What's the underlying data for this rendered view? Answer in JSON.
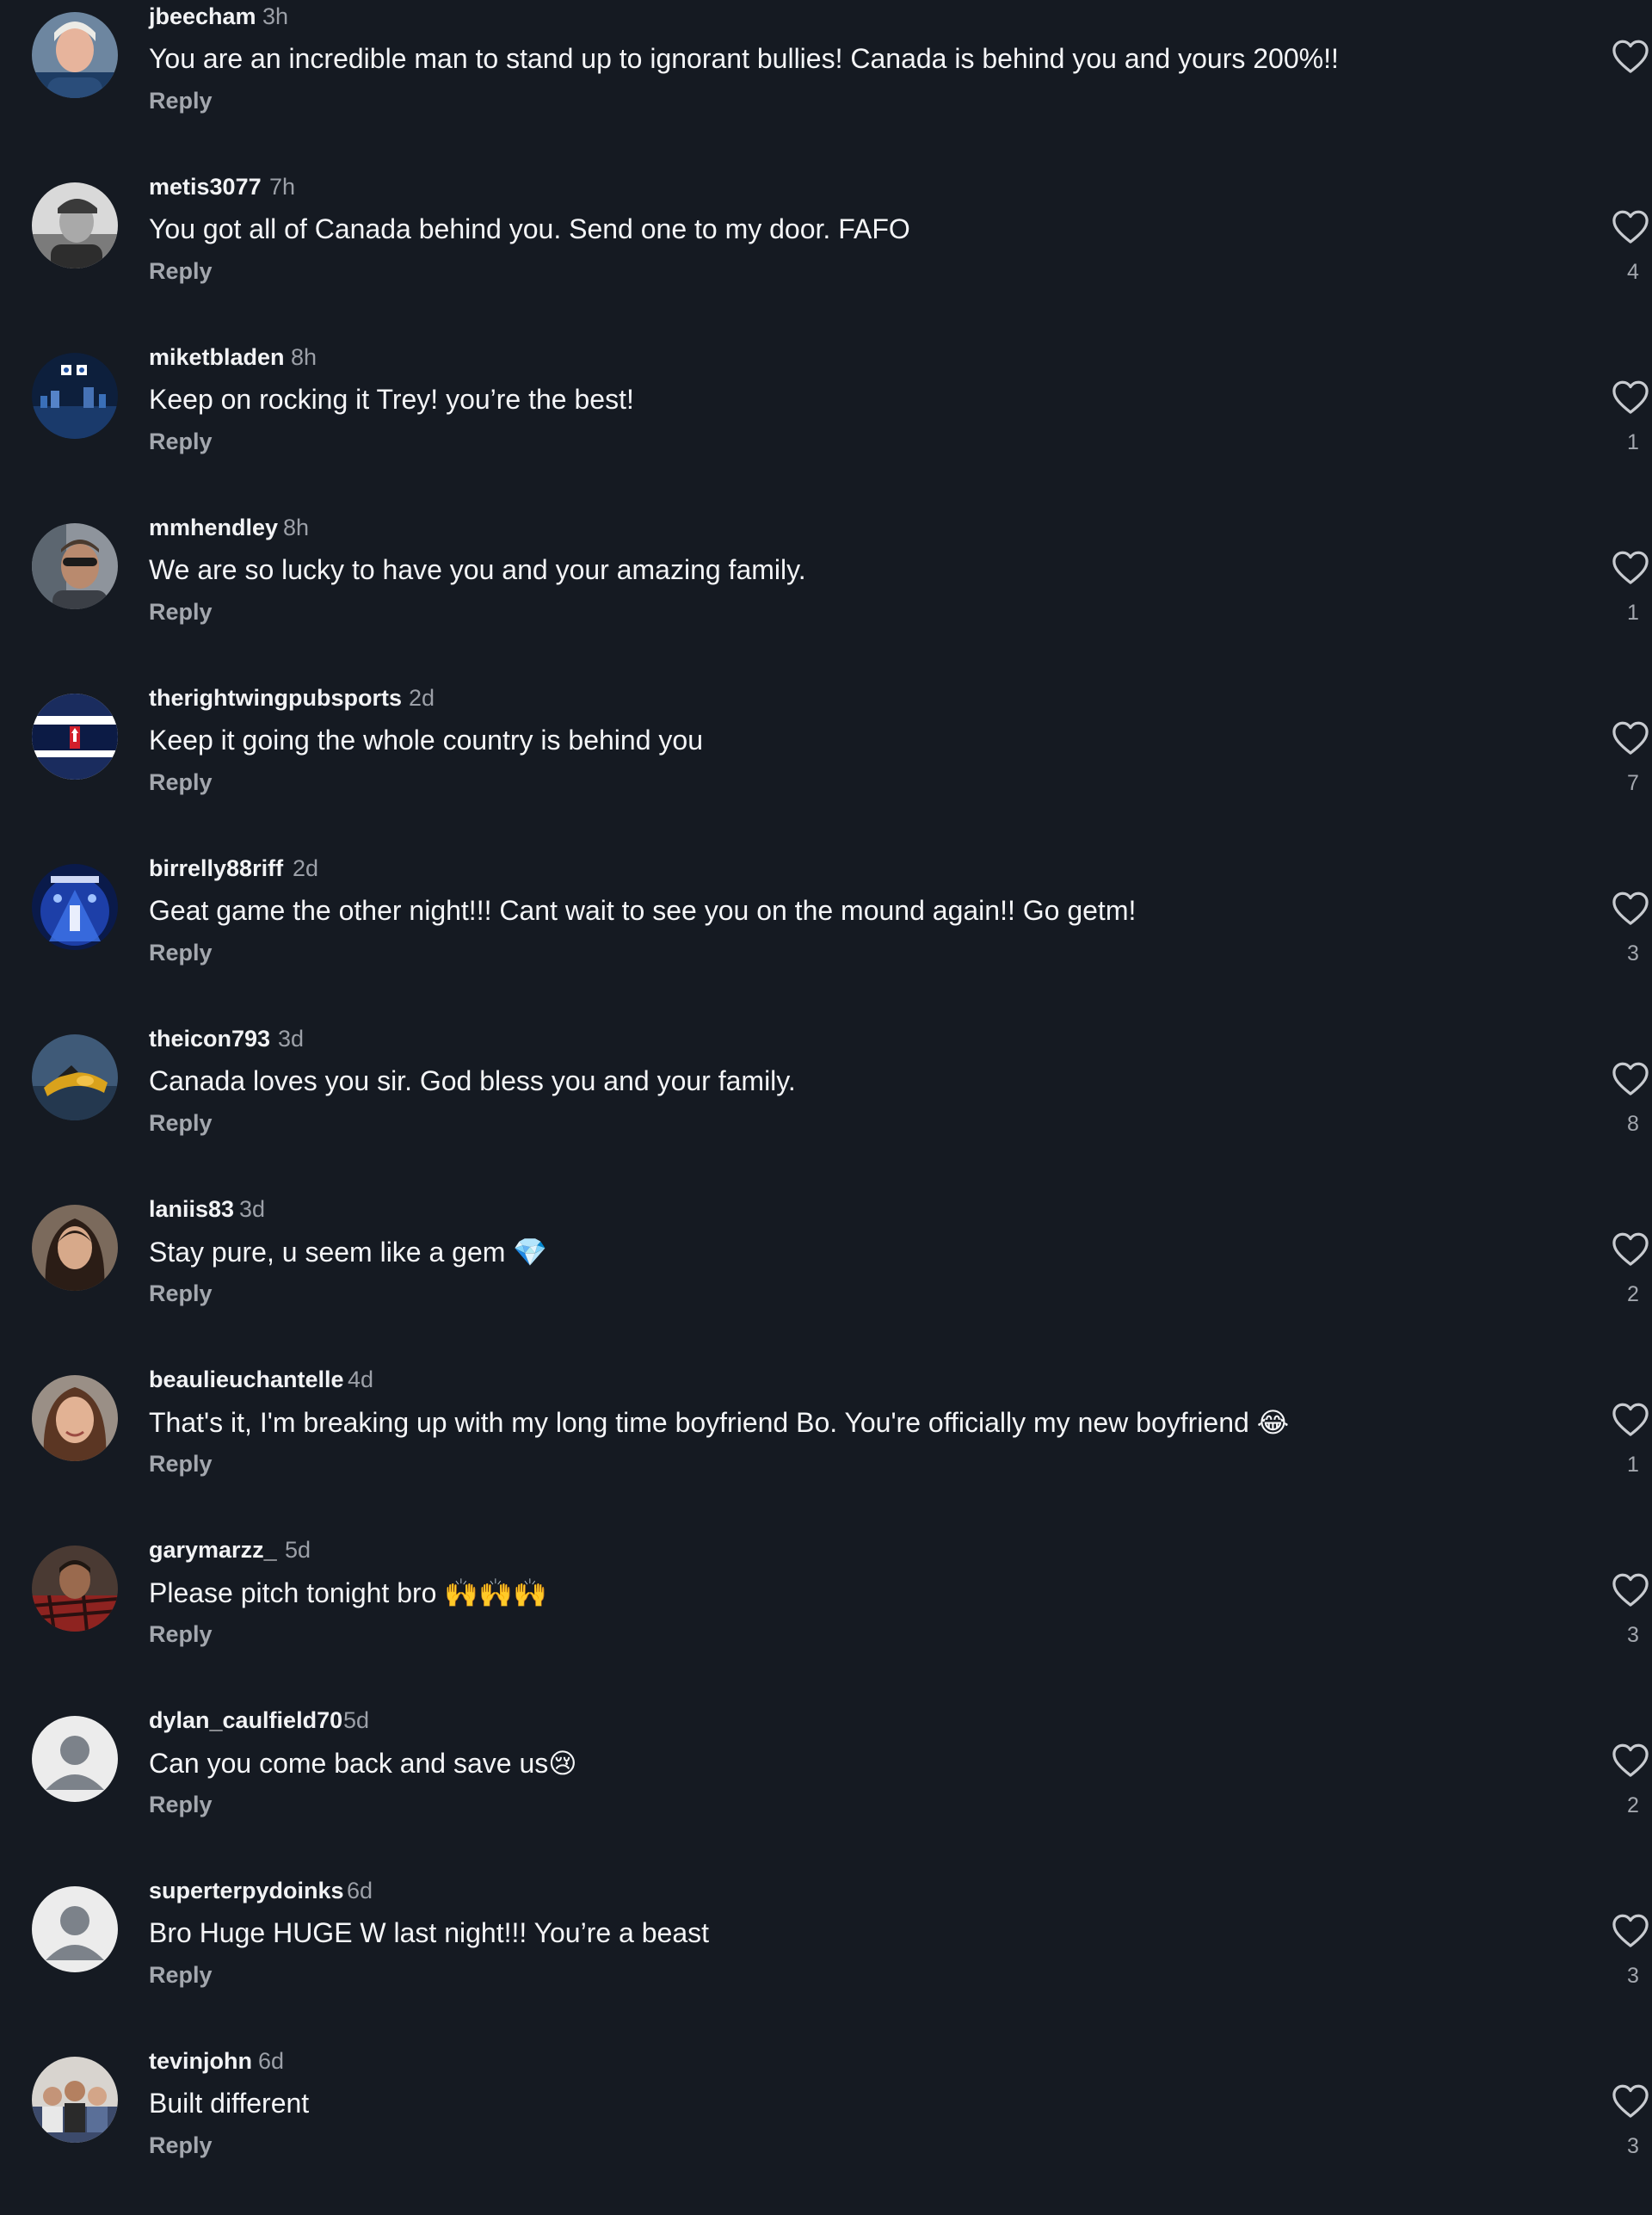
{
  "reply_label": "Reply",
  "colors": {
    "background": "#151a22",
    "text": "#f2f3f5",
    "muted": "#9ca0a8",
    "heart_outline": "#c8cbd0"
  },
  "comments": [
    {
      "username": "jbeecham",
      "time": "3h",
      "text": "You are an incredible man to stand up to ignorant bullies! Canada is behind you and yours 200%!!",
      "likes": "",
      "avatar": "photo-portrait"
    },
    {
      "username": "metis3077",
      "time": "7h",
      "text": "You got all of Canada behind you. Send one to my door. FAFO",
      "likes": "4",
      "avatar": "photo-bw"
    },
    {
      "username": "miketbladen",
      "time": "8h",
      "text": "Keep on rocking it Trey! you’re the best!",
      "likes": "1",
      "avatar": "photo-city-night"
    },
    {
      "username": "mmhendley",
      "time": "8h",
      "text": "We are so lucky to have you and your amazing family.",
      "likes": "1",
      "avatar": "photo-sunglasses"
    },
    {
      "username": "therightwingpubsports",
      "time": "2d",
      "text": "Keep it going the whole country is behind you",
      "likes": "7",
      "avatar": "logo-rtw"
    },
    {
      "username": "birrelly88riff",
      "time": "2d",
      "text": "Geat game the other night!!! Cant wait to see you on the mound again!! Go getm!",
      "likes": "3",
      "avatar": "photo-concert"
    },
    {
      "username": "theicon793",
      "time": "3d",
      "text": "Canada loves you sir. God bless you and your family.",
      "likes": "8",
      "avatar": "photo-jetski"
    },
    {
      "username": "laniis83",
      "time": "3d",
      "text": "Stay pure, u seem like a gem 💎",
      "likes": "2",
      "avatar": "photo-woman-dark-hair"
    },
    {
      "username": "beaulieuchantelle",
      "time": "4d",
      "text": "That's it, I'm breaking up with my long time boyfriend Bo. You're officially my new boyfriend 😂",
      "likes": "1",
      "avatar": "photo-woman-smile"
    },
    {
      "username": "garymarzz_",
      "time": "5d",
      "text": "Please pitch tonight bro 🙌🙌🙌",
      "likes": "3",
      "avatar": "photo-man-plaid"
    },
    {
      "username": "dylan_caulfield70",
      "time": "5d",
      "text": "Can you come back and save us😢",
      "likes": "2",
      "avatar": "default-user-icon"
    },
    {
      "username": "superterpydoinks",
      "time": "6d",
      "text": "Bro Huge HUGE W last night!!! You’re a beast",
      "likes": "3",
      "avatar": "default-user-icon"
    },
    {
      "username": "tevinjohn",
      "time": "6d",
      "text": "Built different",
      "likes": "3",
      "avatar": "photo-group"
    }
  ]
}
